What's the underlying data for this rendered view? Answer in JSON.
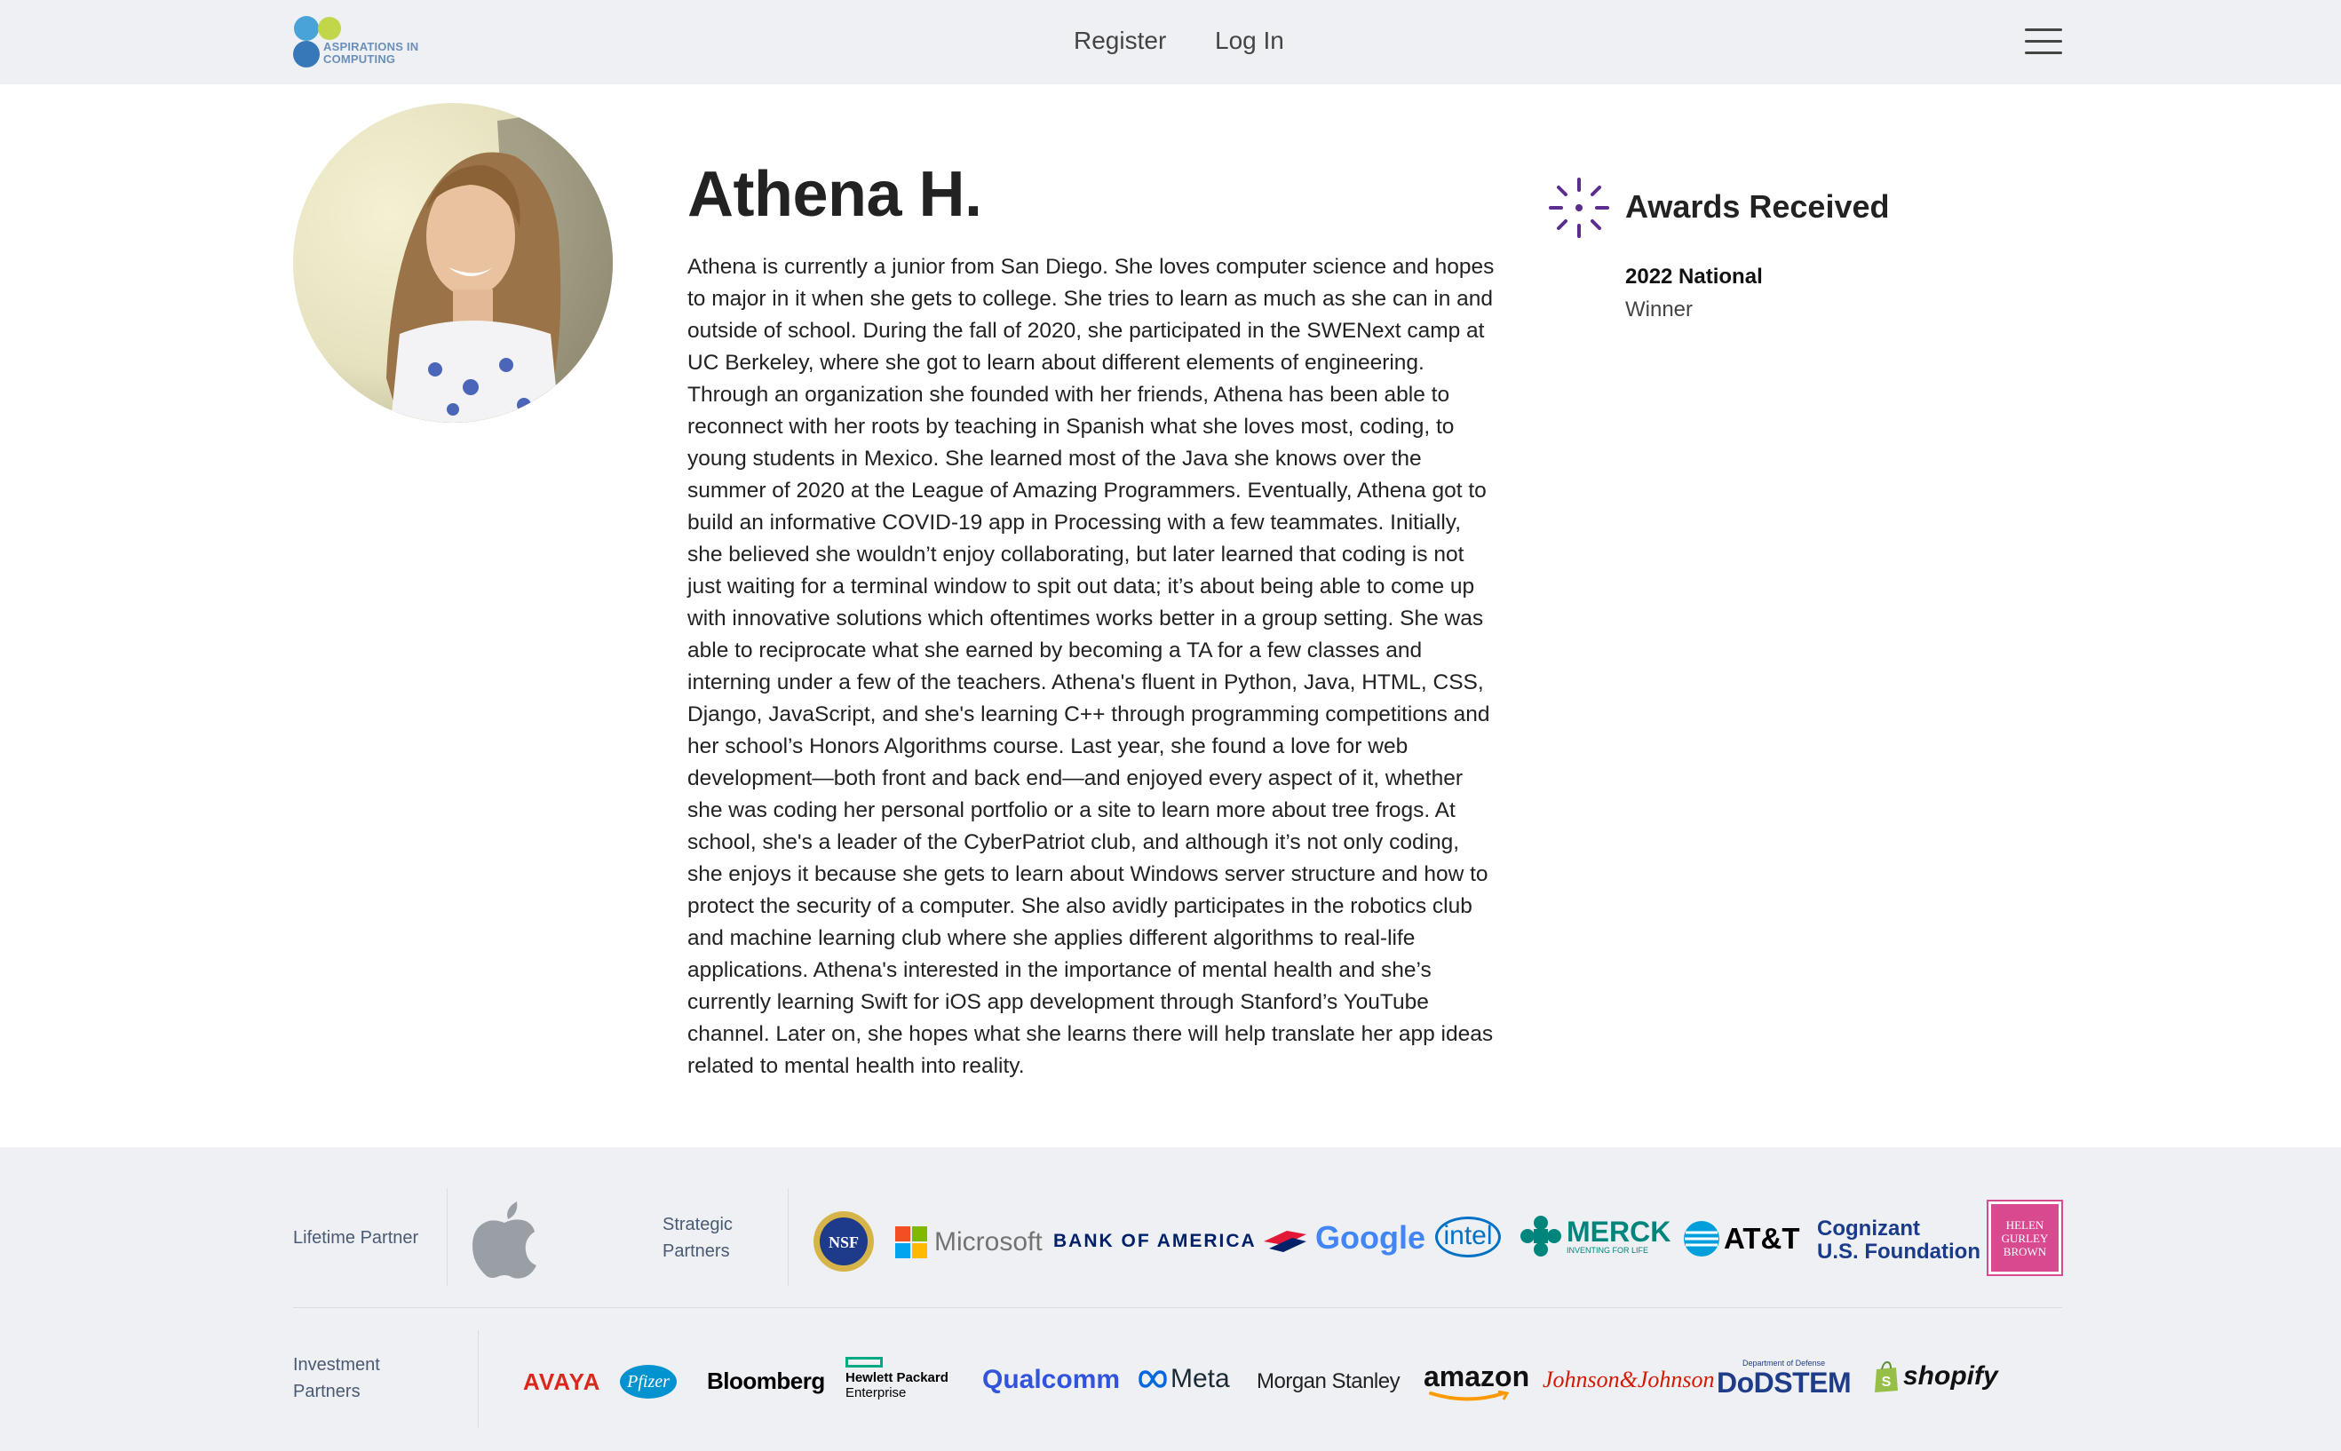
{
  "header": {
    "logo_text_line1": "ASPIRATIONS IN",
    "logo_text_line2": "COMPUTING",
    "nav_register": "Register",
    "nav_login": "Log In"
  },
  "profile": {
    "name": "Athena H.",
    "bio": "Athena is currently a junior from San Diego. She loves computer science and hopes to major in it when she gets to college. She tries to learn as much as she can in and outside of school. During the fall of 2020, she participated in the SWENext camp at UC Berkeley, where she got to learn about different elements of engineering. Through an organization she founded with her friends, Athena has been able to reconnect with her roots by teaching in Spanish what she loves most, coding, to young students in Mexico. She learned most of the Java she knows over the summer of 2020 at the League of Amazing Programmers. Eventually, Athena got to build an informative COVID-19 app in Processing with a few teammates. Initially, she believed she wouldn’t enjoy collaborating, but later learned that coding is not just waiting for a terminal window to spit out data; it’s about being able to come up with innovative solutions which oftentimes works better in a group setting. She was able to reciprocate what she earned by becoming a TA for a few classes and interning under a few of the teachers. Athena's fluent in Python, Java, HTML, CSS, Django, JavaScript, and she's learning C++ through programming competitions and her school’s Honors Algorithms course. Last year, she found a love for web development—both front and back end—and enjoyed every aspect of it, whether she was coding her personal portfolio or a site to learn more about tree frogs. At school, she's a leader of the CyberPatriot club, and although it’s not only coding, she enjoys it because she gets to learn about Windows server structure and how to protect the security of a computer. She also avidly participates in the robotics club and machine learning club where she applies different algorithms to real-life applications. Athena's interested in the importance of mental health and she’s currently learning Swift for iOS app development through Stanford’s YouTube channel. Later on, she hopes what she learns there will help translate her app ideas related to mental health into reality."
  },
  "awards": {
    "title": "Awards Received",
    "items": [
      {
        "year": "2022 National",
        "level": "Winner"
      }
    ],
    "accent_color": "#5b2d8e"
  },
  "footer": {
    "lifetime_partner_label": "Lifetime Partner",
    "strategic_label_1": "Strategic",
    "strategic_label_2": "Partners",
    "investment_label_1": "Investment",
    "investment_label_2": "Partners",
    "strategic_partners": {
      "nsf": "NSF",
      "microsoft": "Microsoft",
      "bank_of_america": "BANK OF AMERICA",
      "google": "Google",
      "intel": "intel",
      "merck": "MERCK",
      "merck_tagline": "INVENTING FOR LIFE",
      "att": "AT&T",
      "cognizant_1": "Cognizant",
      "cognizant_2": "U.S. Foundation",
      "hgb_1": "HELEN",
      "hgb_2": "GURLEY",
      "hgb_3": "BROWN"
    },
    "investment_partners": {
      "avaya": "AVAYA",
      "pfizer": "Pfizer",
      "bloomberg": "Bloomberg",
      "hpe_1": "Hewlett Packard",
      "hpe_2": "Enterprise",
      "qualcomm": "Qualcomm",
      "meta": "Meta",
      "morgan_stanley": "Morgan Stanley",
      "amazon": "amazon",
      "jnj": "Johnson&Johnson",
      "dodstem": "DoDSTEM",
      "dod_top": "Department of Defense",
      "shopify": "shopify"
    }
  }
}
